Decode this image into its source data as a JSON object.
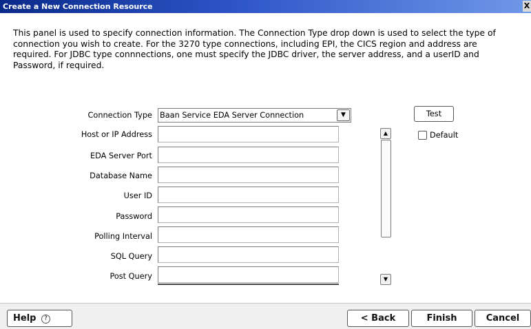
{
  "window": {
    "title": "Create a New Connection Resource",
    "close_glyph": "X"
  },
  "description": "This panel is used to specify connection information.  The Connection Type drop down is used to select the type of connection you wish to create. For the 3270 type connections, including EPI, the CICS region and address are required.  For JDBC type connnections, one must specify the JDBC driver, the server address, and a userID and Password, if required.",
  "form": {
    "connection_type": {
      "label": "Connection Type",
      "value": "Baan Service EDA Server Connection"
    },
    "fields": [
      {
        "label": "Host or IP Address",
        "value": ""
      },
      {
        "label": "EDA Server Port",
        "value": ""
      },
      {
        "label": "Database Name",
        "value": ""
      },
      {
        "label": "User ID",
        "value": ""
      },
      {
        "label": "Password",
        "value": ""
      },
      {
        "label": "Polling Interval",
        "value": ""
      },
      {
        "label": "SQL Query",
        "value": ""
      },
      {
        "label": "Post Query",
        "value": ""
      }
    ]
  },
  "actions": {
    "test_label": "Test",
    "default_label": "Default",
    "default_checked": false
  },
  "footer": {
    "help_label": "Help",
    "back_label": "< Back",
    "finish_label": "Finish",
    "cancel_label": "Cancel"
  },
  "icons": {
    "help": "help-circle-icon",
    "dropdown": "chevron-down-icon",
    "scroll_up": "chevron-up-icon",
    "scroll_down": "chevron-down-icon"
  }
}
